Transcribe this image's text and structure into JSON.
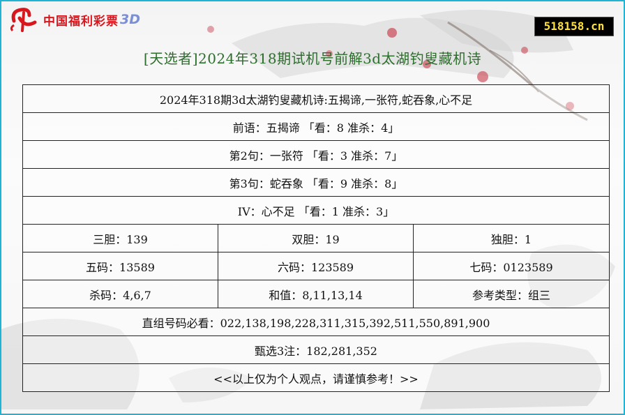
{
  "logo": {
    "brand": "中国福利彩票",
    "suffix": "3D"
  },
  "site_badge": "518158.cn",
  "page_title": "[天选者]2024年318期试机号前解3d太湖钓叟藏机诗",
  "rows": {
    "poem": "2024年318期3d太湖钓叟藏机诗:五揭谛,一张符,蛇吞象,心不足",
    "line1": "前语：五揭谛 「看：8 准杀：4」",
    "line2": "第2句：一张符 「看：3 准杀：7」",
    "line3": "第3句：蛇吞象 「看：9 准杀：8」",
    "line4": "IV：心不足 「看：1 准杀：3」",
    "dan": [
      "三胆：139",
      "双胆：19",
      "独胆：1"
    ],
    "codes": [
      "五码：13589",
      "六码：123589",
      "七码：0123589"
    ],
    "misc": [
      "杀码：4,6,7",
      "和值：8,11,13,14",
      "参考类型：组三"
    ],
    "direct": "直组号码必看：022,138,198,228,311,315,392,511,550,891,900",
    "picks": "甄选3注：182,281,352",
    "disclaimer": "<<以上仅为个人观点，请谨慎参考！>>"
  },
  "colors": {
    "frame_border": "#1fb3d6",
    "title_text": "#2c6e2c",
    "logo_red": "#d7161e",
    "logo_3d": "#7b8fd6",
    "badge_bg": "#000000",
    "badge_text": "#ffe23a"
  }
}
